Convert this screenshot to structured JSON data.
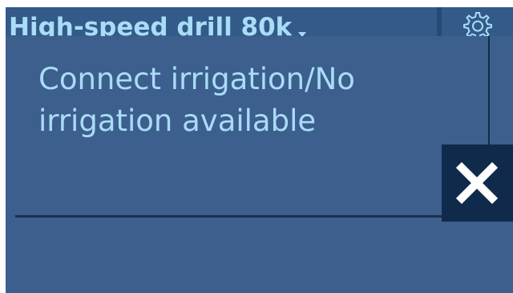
{
  "header": {
    "device_title": "High-speed drill 80k",
    "dropdown_icon": "triangle-down-icon",
    "settings_icon": "gear-icon"
  },
  "popup": {
    "message": "Connect irrigation/No irrigation available",
    "close_icon": "close-icon"
  },
  "colors": {
    "header_bg": "#335a88",
    "body_bg": "#3c5f8d",
    "text": "#a9dcf7",
    "close_bg": "#102a4c",
    "divider": "#1b2f4d"
  }
}
